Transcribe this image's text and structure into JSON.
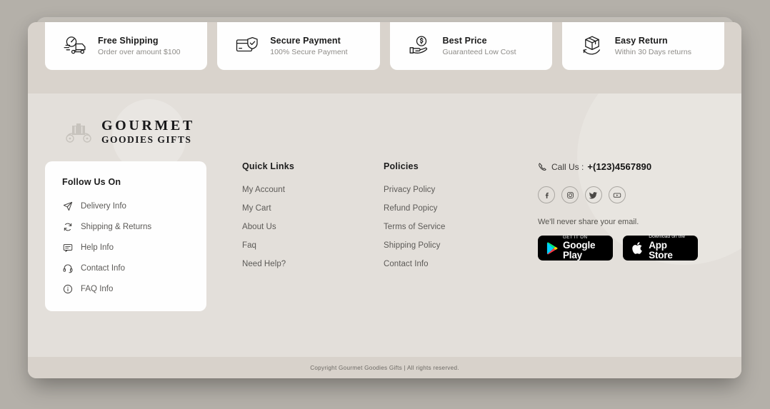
{
  "features": [
    {
      "icon": "delivery-truck-icon",
      "title": "Free Shipping",
      "subtitle": "Order over amount $100"
    },
    {
      "icon": "credit-card-shield-icon",
      "title": "Secure Payment",
      "subtitle": "100% Secure Payment"
    },
    {
      "icon": "hand-dollar-icon",
      "title": "Best Price",
      "subtitle": "Guaranteed Low Cost"
    },
    {
      "icon": "box-return-icon",
      "title": "Easy Return",
      "subtitle": "Within 30 Days returns"
    }
  ],
  "brand": {
    "logo_icon": "carriage-icon",
    "line1": "GOURMET",
    "line2": "GOODIES GIFTS"
  },
  "follow": {
    "title": "Follow Us On",
    "items": [
      {
        "icon": "paper-plane-icon",
        "label": "Delivery Info"
      },
      {
        "icon": "return-arrows-icon",
        "label": "Shipping & Returns"
      },
      {
        "icon": "chat-bubble-icon",
        "label": "Help Info"
      },
      {
        "icon": "headset-icon",
        "label": "Contact Info"
      },
      {
        "icon": "info-circle-icon",
        "label": "FAQ Info"
      }
    ]
  },
  "quick_links": {
    "title": "Quick Links",
    "items": [
      "My Account",
      "My Cart",
      "About Us",
      "Faq",
      "Need Help?"
    ]
  },
  "policies": {
    "title": "Policies",
    "items": [
      "Privacy Policy",
      "Refund Popicy",
      "Terms of Service",
      "Shipping Policy",
      "Contact Info"
    ]
  },
  "contact": {
    "phone_icon": "phone-icon",
    "call_label": "Call Us :",
    "phone_number": "+(123)4567890",
    "socials": [
      {
        "icon": "facebook-icon",
        "name": "Facebook"
      },
      {
        "icon": "instagram-icon",
        "name": "Instagram"
      },
      {
        "icon": "twitter-icon",
        "name": "Twitter"
      },
      {
        "icon": "youtube-icon",
        "name": "YouTube"
      }
    ],
    "share_note": "We'll never share your email.",
    "stores": [
      {
        "icon": "google-play-icon",
        "small": "GET IT ON",
        "big": "Google Play"
      },
      {
        "icon": "apple-icon",
        "small": "Download on the",
        "big": "App Store"
      }
    ]
  },
  "copyright": "Copyright Gourmet Goodies Gifts | All rights reserved.",
  "colors": {
    "page_background": "#b4b0a9",
    "panel_background": "#ded9d3",
    "features_band": "#d9d3cc",
    "footer_background": "#e3dfda",
    "card_background": "#fefefe",
    "copyright_bar": "#d8d2cb",
    "text_dark": "#1c1c1c",
    "text_muted": "#5c5a57"
  }
}
